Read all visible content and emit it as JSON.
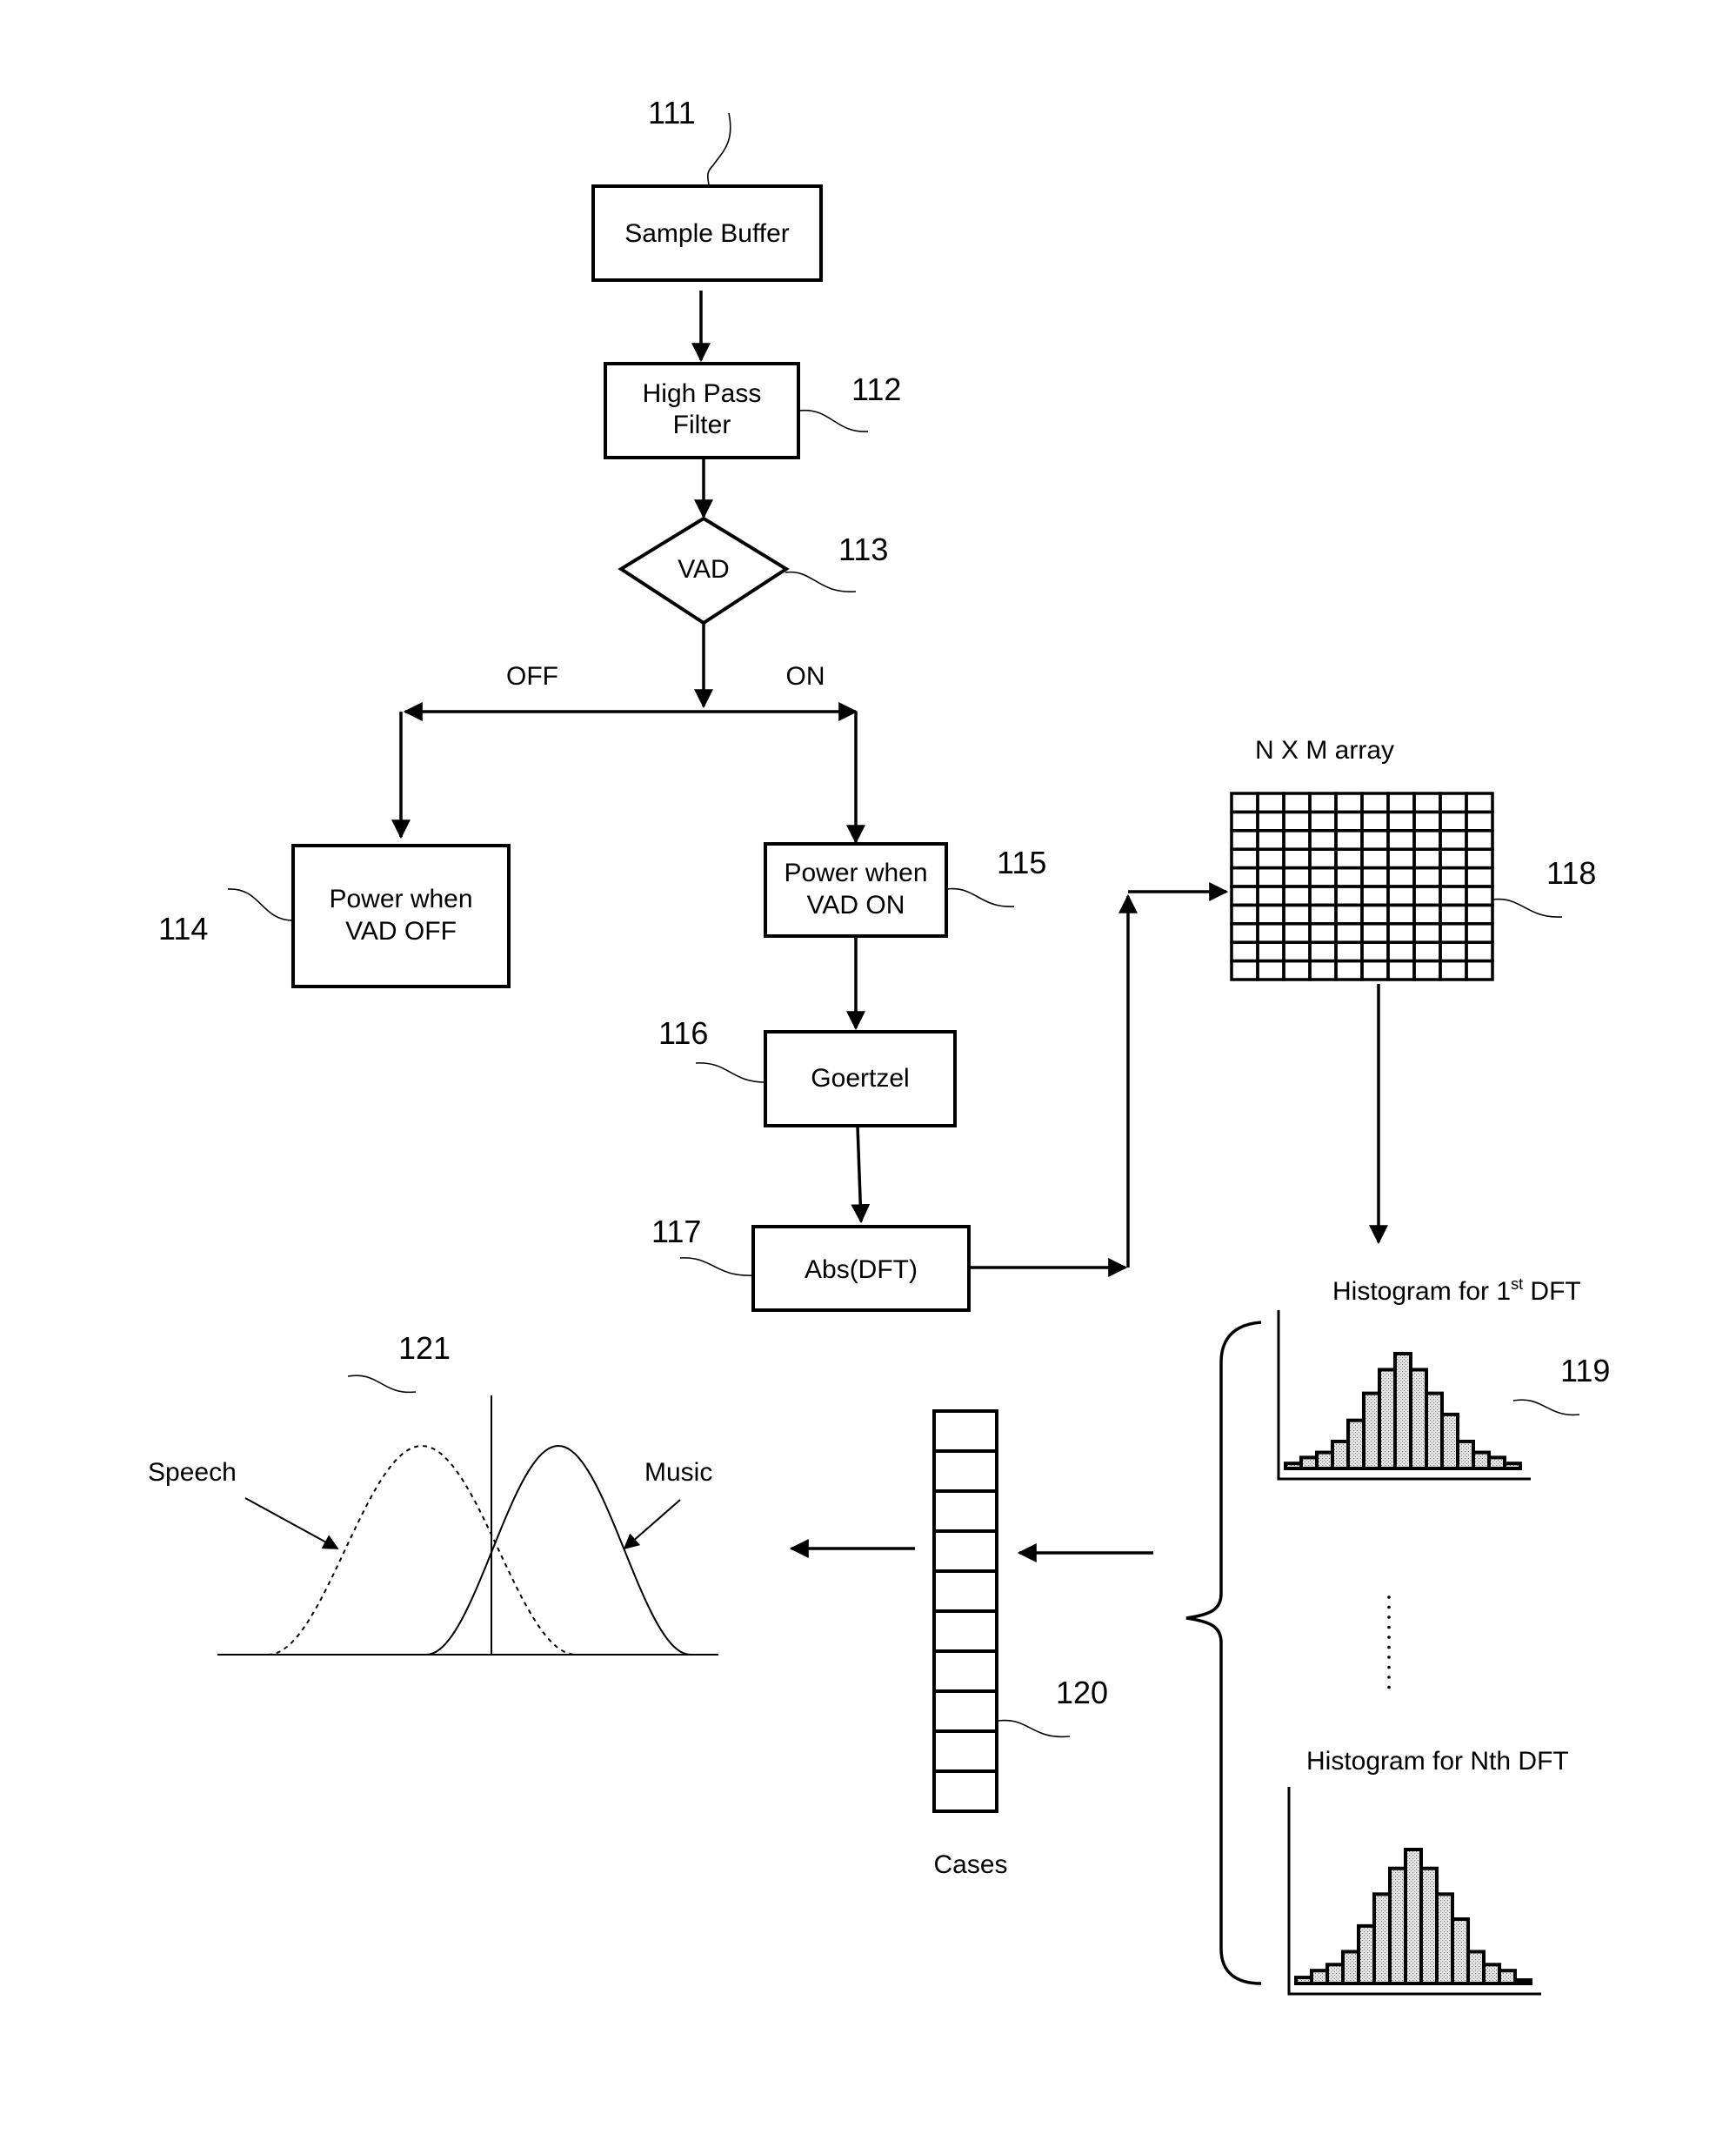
{
  "diagram": {
    "nodes": {
      "sample_buffer": {
        "ref": "111",
        "label": "Sample Buffer"
      },
      "high_pass_filter": {
        "ref": "112",
        "label_line1": "High Pass",
        "label_line2": "Filter"
      },
      "vad": {
        "ref": "113",
        "label": "VAD"
      },
      "power_vad_off": {
        "ref": "114",
        "label_line1": "Power when",
        "label_line2": "VAD OFF"
      },
      "power_vad_on": {
        "ref": "115",
        "label_line1": "Power when",
        "label_line2": "VAD ON"
      },
      "goertzel": {
        "ref": "116",
        "label": "Goertzel"
      },
      "abs_dft": {
        "ref": "117",
        "label": "Abs(DFT)"
      },
      "nxm_array": {
        "ref": "118",
        "title": "N X M array",
        "rows": 10,
        "cols": 10
      },
      "histograms": {
        "ref": "119",
        "first": {
          "title_pre": "Histogram for 1",
          "title_sup": "st",
          "title_post": " DFT",
          "values": [
            6,
            13,
            19,
            32,
            57,
            89,
            117,
            136,
            117,
            89,
            64,
            32,
            19,
            13,
            6
          ]
        },
        "nth": {
          "title": "Histogram for Nth DFT",
          "values": [
            7,
            15,
            22,
            37,
            67,
            104,
            134,
            156,
            134,
            104,
            75,
            37,
            22,
            15,
            4
          ]
        }
      },
      "cases": {
        "ref": "120",
        "label": "Cases",
        "cells": 10
      },
      "distributions": {
        "ref": "121",
        "speech_label": "Speech",
        "music_label": "Music"
      }
    },
    "branches": {
      "off_label": "OFF",
      "on_label": "ON"
    }
  }
}
